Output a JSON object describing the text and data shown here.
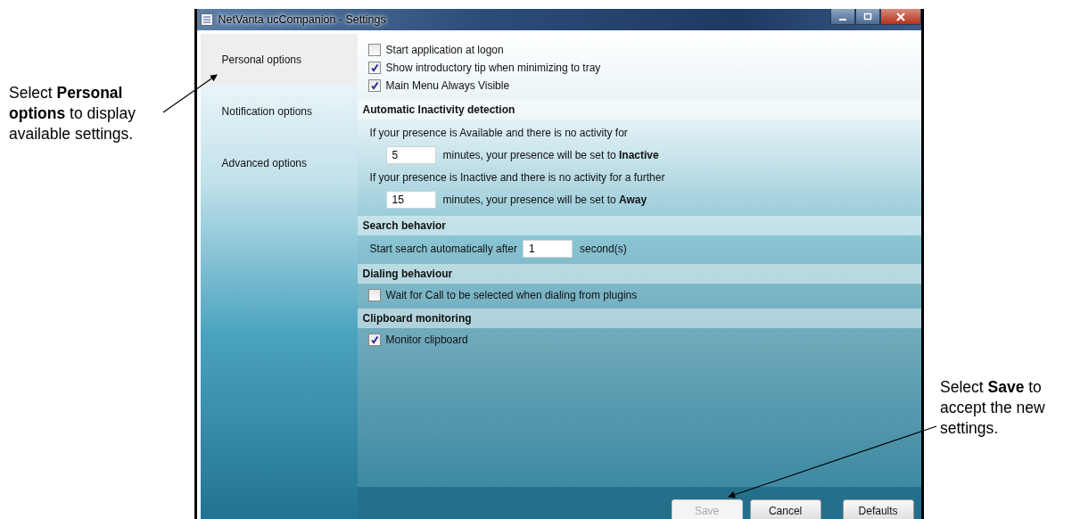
{
  "callouts": [
    {
      "text": "Select **Personal options** to display available settings."
    },
    {
      "text": "Select **Save** to accept the new settings."
    }
  ],
  "window": {
    "title": "NetVanta ucCompanion  - Settings"
  },
  "sidebar": {
    "items": [
      {
        "label": "Personal options",
        "selected": true
      },
      {
        "label": "Notification options",
        "selected": false
      },
      {
        "label": "Advanced options",
        "selected": false
      }
    ]
  },
  "options": [
    {
      "label": "Start application at logon",
      "checked": false
    },
    {
      "label": "Show introductory tip when minimizing to tray",
      "checked": true
    },
    {
      "label": "Main Menu Always Visible",
      "checked": true
    }
  ],
  "sections": [
    {
      "heading": "Automatic Inactivity detection",
      "rows": [
        {
          "kind": "text",
          "text": "If your presence is Available and there is no activity for"
        },
        {
          "kind": "field",
          "value": "5",
          "after": "minutes, your presence will be set to **Inactive**"
        },
        {
          "kind": "text",
          "text": "If your presence is Inactive and there is no activity for a further"
        },
        {
          "kind": "field",
          "value": "15",
          "after": "minutes, your presence will be set to **Away**"
        }
      ]
    },
    {
      "heading": "Search behavior",
      "rows": [
        {
          "kind": "inline",
          "before": "Start search automatically after",
          "value": "1",
          "after": "second(s)"
        }
      ]
    },
    {
      "heading": "Dialing behaviour",
      "rows": [
        {
          "kind": "checkbox",
          "label": "Wait for Call to be selected when dialing from plugins",
          "checked": false
        }
      ]
    },
    {
      "heading": "Clipboard monitoring",
      "rows": [
        {
          "kind": "checkbox",
          "label": "Monitor clipboard",
          "checked": true
        }
      ]
    }
  ],
  "buttons": [
    {
      "label": "Save",
      "disabled": true
    },
    {
      "label": "Cancel",
      "disabled": false
    },
    {
      "label": "Defaults",
      "disabled": false
    }
  ]
}
